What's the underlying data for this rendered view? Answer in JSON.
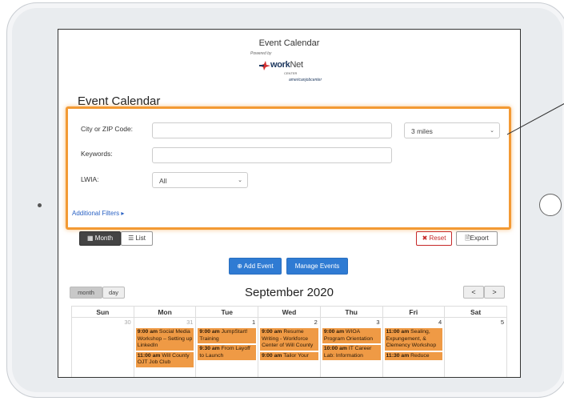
{
  "site": {
    "title": "Event Calendar",
    "logo": {
      "powered_by": "Powered by",
      "brand_work": "work",
      "brand_net": "Net",
      "sub": "CENTER",
      "partner": "americanjobcenter"
    }
  },
  "page_heading": "Event Calendar",
  "filters": {
    "city_zip": {
      "label": "City or ZIP Code:",
      "value": ""
    },
    "radius": {
      "value": "3 miles"
    },
    "keywords": {
      "label": "Keywords:",
      "value": ""
    },
    "lwia": {
      "label": "LWIA:",
      "value": "All"
    },
    "additional_filters": "Additional Filters ▸"
  },
  "toolbar": {
    "month_label": "Month",
    "list_label": "List",
    "reset_label": "Reset",
    "export_label": "Export",
    "add_event_label": "Add Event",
    "manage_events_label": "Manage Events"
  },
  "calendar": {
    "view_month": "month",
    "view_day": "day",
    "month_title": "September 2020",
    "prev": "<",
    "next": ">",
    "weekdays": [
      "Sun",
      "Mon",
      "Tue",
      "Wed",
      "Thu",
      "Fri",
      "Sat"
    ],
    "days": [
      {
        "num": "30",
        "other": true,
        "events": []
      },
      {
        "num": "31",
        "other": true,
        "events": [
          {
            "time": "9:00 am",
            "title": "Social Media Workshop – Setting up LinkedIn"
          },
          {
            "time": "11:00 am",
            "title": "Will County OJT Job Club"
          }
        ]
      },
      {
        "num": "1",
        "other": false,
        "events": [
          {
            "time": "9:00 am",
            "title": "JumpStart! Training"
          },
          {
            "time": "9:30 am",
            "title": "From Layoff to Launch"
          }
        ]
      },
      {
        "num": "2",
        "other": false,
        "events": [
          {
            "time": "9:00 am",
            "title": "Resume Writing - Workforce Center of Will County"
          },
          {
            "time": "9:00 am",
            "title": "Tailor Your"
          }
        ]
      },
      {
        "num": "3",
        "other": false,
        "events": [
          {
            "time": "9:00 am",
            "title": "WIOA Program Orientation"
          },
          {
            "time": "10:00 am",
            "title": "IT Career Lab: Information"
          }
        ]
      },
      {
        "num": "4",
        "other": false,
        "events": [
          {
            "time": "11:00 am",
            "title": "Sealing, Expungement, & Clemency Workshop"
          },
          {
            "time": "11:30 am",
            "title": "Reduce"
          }
        ]
      },
      {
        "num": "5",
        "other": false,
        "events": []
      }
    ]
  },
  "colors": {
    "highlight": "#f39a34",
    "primary": "#2f7bd3",
    "event": "#ef9a45"
  }
}
